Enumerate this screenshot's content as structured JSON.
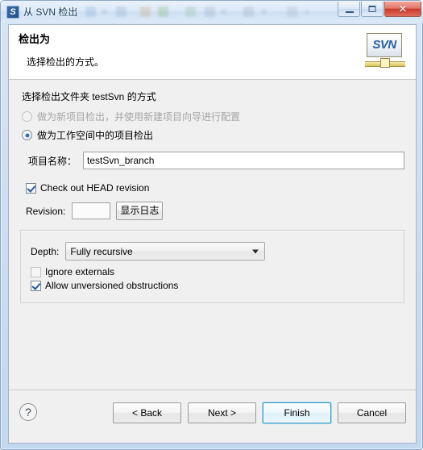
{
  "window": {
    "title": "从 SVN 检出",
    "icon": "svn-icon",
    "controls": {
      "minimize": "minimize-icon",
      "maximize": "maximize-icon",
      "close": "✕"
    }
  },
  "banner": {
    "title": "检出为",
    "subtitle": "选择检出的方式。",
    "logo_text": "SVN"
  },
  "main": {
    "prompt": "选择检出文件夹 testSvn 的方式",
    "radios": [
      {
        "label": "做为新项目检出，并使用新建项目向导进行配置",
        "checked": false,
        "disabled": true
      },
      {
        "label": "做为工作空间中的项目检出",
        "checked": true,
        "disabled": false
      }
    ],
    "project_name": {
      "label": "项目名称：",
      "value": "testSvn_branch"
    },
    "head_revision": {
      "label": "Check out HEAD revision",
      "checked": true
    },
    "revision": {
      "label": "Revision:",
      "value": "",
      "show_log_button": "显示日志"
    },
    "depth": {
      "label": "Depth:",
      "value": "Fully recursive"
    },
    "ignore_externals": {
      "label": "Ignore externals",
      "checked": false
    },
    "allow_unversioned": {
      "label": "Allow unversioned obstructions",
      "checked": true
    }
  },
  "footer": {
    "help": "?",
    "back": "< Back",
    "next": "Next >",
    "finish": "Finish",
    "cancel": "Cancel"
  },
  "colors": {
    "accent": "#2a6fb8",
    "default_button_border": "#3a93c3",
    "close_button": "#c9392a",
    "logo_blue": "#2a5ea8",
    "logo_gold": "#d9c35e"
  }
}
